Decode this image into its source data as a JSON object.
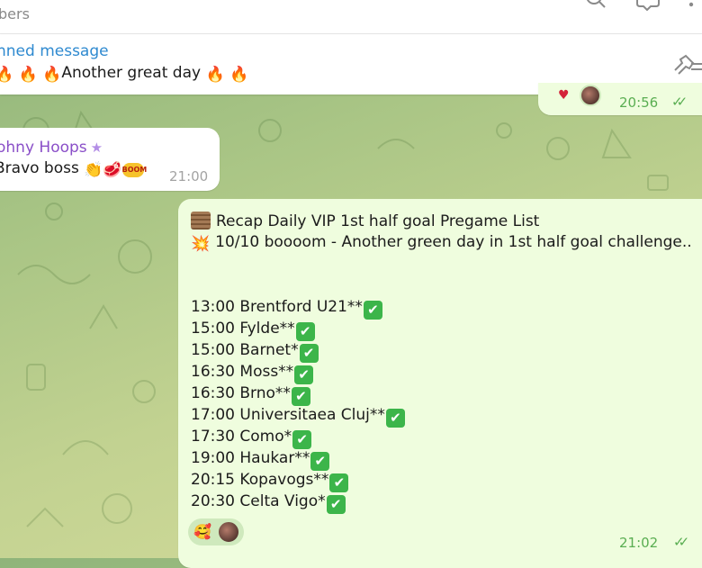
{
  "header": {
    "subtitle": "bers",
    "icons": [
      "search-icon",
      "discussion-icon",
      "more-icon"
    ]
  },
  "pinned": {
    "title": "nned message",
    "text": "Another great day",
    "icon": "unpin-icon"
  },
  "messages": {
    "prev_out": {
      "time": "20:56",
      "status": "read"
    },
    "incoming": {
      "sender": "ohny Hoops",
      "text": "Bravo boss",
      "time": "21:00"
    },
    "main_out": {
      "header_line1": "Recap Daily VIP 1st half goal Pregame List",
      "header_line2": "10/10 boooom - Another green day in 1st half goal challenge..",
      "picks": [
        "13:00 Brentford U21**",
        "15:00  Fylde**",
        "15:00 Barnet*",
        "16:30 Moss**",
        "16:30 Brno**",
        "17:00 Universitaea Cluj**",
        "17:30 Como*",
        "19:00 Haukar**",
        "20:15  Kopavogs**",
        "20:30 Celta Vigo*"
      ],
      "time": "21:02",
      "status": "read"
    }
  },
  "colors": {
    "accent_link": "#2f8ad0",
    "sender_name": "#8a4fc8",
    "outgoing_bubble": "#effdde",
    "check_green": "#3cb54a"
  }
}
